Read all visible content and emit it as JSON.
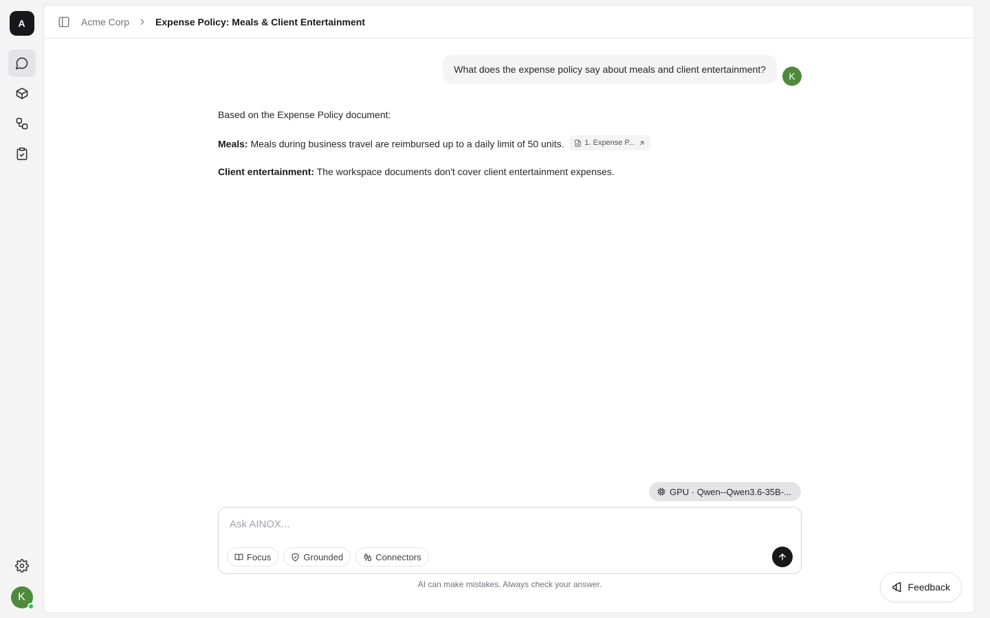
{
  "rail": {
    "logo_letter": "A",
    "nav": [
      {
        "name": "chat",
        "icon": "chat-bubble-icon",
        "active": true
      },
      {
        "name": "models",
        "icon": "cube-icon",
        "active": false
      },
      {
        "name": "workflows",
        "icon": "workflow-icon",
        "active": false
      },
      {
        "name": "tasks",
        "icon": "clipboard-check-icon",
        "active": false
      }
    ],
    "settings_icon": "gear-icon",
    "user_initial": "K"
  },
  "header": {
    "workspace": "Acme Corp",
    "title": "Expense Policy: Meals & Client Entertainment"
  },
  "conversation": {
    "user_message": "What does the expense policy say about meals and client entertainment?",
    "user_initial": "K",
    "answer": {
      "intro": "Based on the Expense Policy document:",
      "meals_label": "Meals:",
      "meals_text": "Meals during business travel are reimbursed up to a daily limit of 50 units.",
      "citation": "1. Expense P...",
      "entertainment_label": "Client entertainment:",
      "entertainment_text": "The workspace documents don't cover client entertainment expenses."
    }
  },
  "composer": {
    "model": "GPU · Qwen--Qwen3.6-35B-...",
    "placeholder": "Ask AINOX...",
    "value": "",
    "chips": [
      "Focus",
      "Grounded",
      "Connectors"
    ],
    "disclaimer": "AI can make mistakes. Always check your answer."
  },
  "feedback_label": "Feedback",
  "colors": {
    "accent_avatar": "#4d8a3c",
    "online": "#22c55e",
    "primary": "#18181b"
  }
}
